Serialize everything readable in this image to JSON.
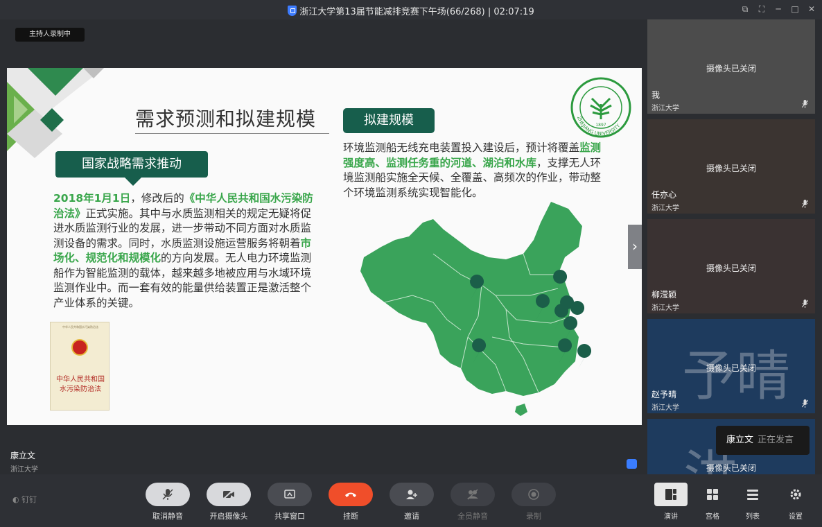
{
  "window": {
    "title": "浙江大学第13届节能减排竞赛下午场(66/268) | 02:07:19"
  },
  "stage": {
    "recording_badge": "主持人录制中",
    "speaker_name": "康立文",
    "speaker_org": "浙江大学"
  },
  "slide": {
    "title": "需求预测和拟建规模",
    "tag_left": "国家战略需求推动",
    "tag_right": "拟建规模",
    "left_p1_hl1": "2018年1月1日",
    "left_p1_t1": "，修改后的",
    "left_p1_hl2": "《中华人民共和国水污染防治法》",
    "left_p1_t2": "正式实施。其中与水质监测相关的规定无疑将促进水质监测行业的发展，进一步带动不同方面对水质监测设备的需求。同时，水质监测设施运营服务将朝着",
    "left_p1_hl3": "市场化、规范化和规模化",
    "left_p1_t3": "的方向发展。无人电力环境监测船作为智能监测的载体，越来越多地被应用与水域环境监测作业中。而一套有效的能量供给装置正是激活整个产业体系的关键。",
    "right_t1": "环境监测船无线充电装置投入建设后，预计将覆盖",
    "right_hl1": "监测强度高、监测任务重的河道、湖泊和水库",
    "right_t2": "，支撑无人环境监测船实施全天候、全覆盖、高频次的作业，带动整个环境监测系统实现智能化。",
    "book_title_line1": "中华人民共和国",
    "book_title_line2": "水污染防治法",
    "book_header": "中华人民共和国水污染防治法",
    "logo_text": "ZHEJIANG UNIVERSITY",
    "logo_year": "1897"
  },
  "participants": [
    {
      "name": "我",
      "org": "浙江大学",
      "status": "摄像头已关闭",
      "bg": "#4a4a4a"
    },
    {
      "name": "任亦心",
      "org": "浙江大学",
      "status": "摄像头已关闭",
      "bg": "#3b3532"
    },
    {
      "name": "柳滢颖",
      "org": "浙江大学",
      "status": "摄像头已关闭",
      "bg": "#3a3333"
    },
    {
      "name": "赵予晴",
      "org": "浙江大学",
      "status": "摄像头已关闭",
      "bg": "#1d3a5c",
      "bigtext": "予晴"
    },
    {
      "name": "",
      "org": "",
      "status": "摄像头已关闭",
      "bg": "#1d3a5c",
      "bigtext": "洪"
    }
  ],
  "toast": {
    "who": "康立文",
    "what": "正在发言"
  },
  "toolbar": {
    "brand": "钉钉",
    "unmute": "取消静音",
    "camera": "开启摄像头",
    "share": "共享窗口",
    "hangup": "挂断",
    "invite": "邀请",
    "mute_all": "全员静音",
    "record": "录制",
    "view_speaker": "演讲",
    "view_grid": "宫格",
    "view_list": "列表",
    "settings": "设置"
  }
}
